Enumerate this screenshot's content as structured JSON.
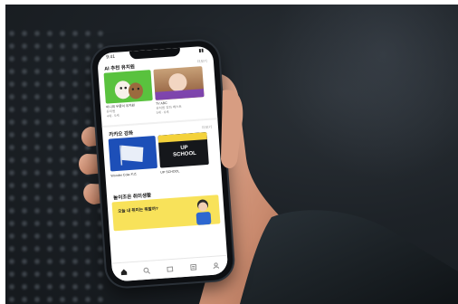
{
  "photo": {
    "subject": "hand-holding-smartphone"
  },
  "app": {
    "status_time": "9:41",
    "section1": {
      "title": "AI 추천 유치원",
      "more": "더보기",
      "items": [
        {
          "caption": "미니의 우쭐이 유치원",
          "sub": "유치원",
          "meta": "4세 · 5세"
        },
        {
          "caption": "TV ABC",
          "sub": "유치원 강좌 베스트",
          "meta": "5세 · 6세"
        }
      ]
    },
    "section2": {
      "title": "카카오 강좌",
      "more": "더보기",
      "items": [
        {
          "caption": "Wonder Cola 키즈",
          "sub": "",
          "thumb_text": ""
        },
        {
          "caption": "UP SCHOOL",
          "sub": "",
          "thumb_text": "UP SCHOOL"
        }
      ]
    },
    "section3": {
      "title": "놀이조은 취미생활",
      "banner_text": "오늘 내 취미는 뭐할까?"
    },
    "tabs": [
      "home-icon",
      "search-icon",
      "box-icon",
      "list-icon",
      "person-icon"
    ]
  },
  "colors": {
    "banner": "#f8e25a",
    "accent_green": "#55c43c",
    "accent_purple": "#6a4fc8",
    "blue_card": "#1d4fb8"
  }
}
